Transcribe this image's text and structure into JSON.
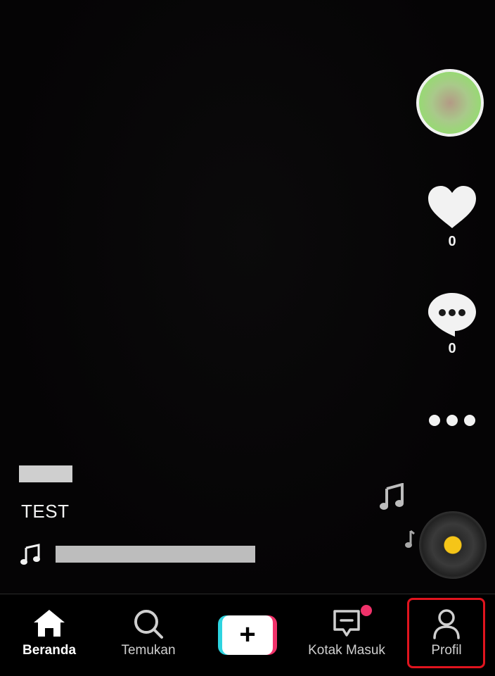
{
  "video": {
    "caption": "TEST",
    "like_count": "0",
    "comment_count": "0"
  },
  "icons": {
    "avatar": "avatar",
    "like": "heart-icon",
    "comment": "comment-bubble-icon",
    "more": "more-dots-icon",
    "music": "music-note-icon",
    "disc": "music-disc"
  },
  "bottom_nav": {
    "items": [
      {
        "label": "Beranda",
        "icon": "home-icon",
        "active": true
      },
      {
        "label": "Temukan",
        "icon": "search-icon",
        "active": false
      },
      {
        "label": "",
        "icon": "plus-icon",
        "active": false
      },
      {
        "label": "Kotak Masuk",
        "icon": "inbox-icon",
        "active": false
      },
      {
        "label": "Profil",
        "icon": "profile-icon",
        "active": false
      }
    ]
  },
  "colors": {
    "background": "#050405",
    "highlight_border": "#e0141e",
    "accent_pink": "#f0326a",
    "accent_cyan": "#2dd4e0",
    "disc_center": "#f5c518"
  }
}
